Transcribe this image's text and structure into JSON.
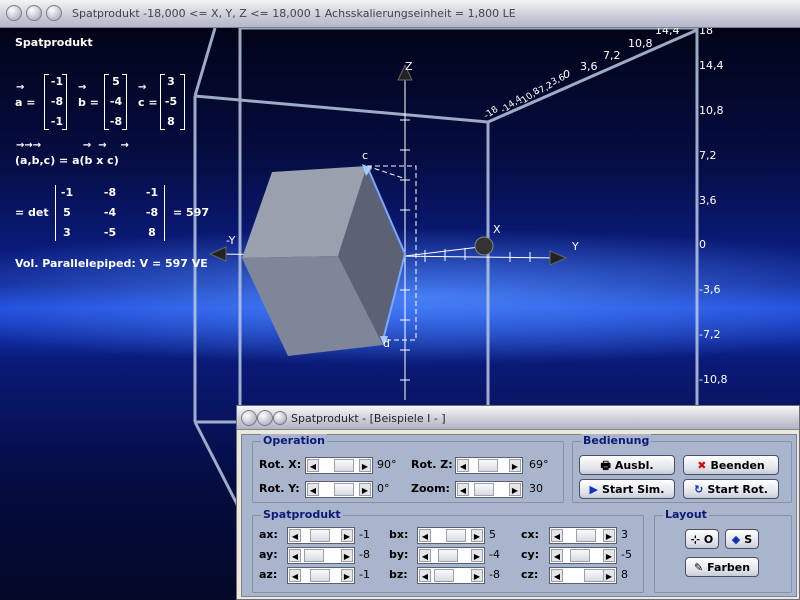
{
  "window": {
    "title": "Spatprodukt   -18,000 <= X, Y, Z <= 18,000    1 Achsskalierungseinheit = 1,800 LE"
  },
  "info": {
    "heading": "Spatprodukt",
    "vectors": {
      "a_label": "a =",
      "b_label": "b =",
      "c_label": "c =",
      "a": [
        "-1",
        "-8",
        "-1"
      ],
      "b": [
        "5",
        "-4",
        "-8"
      ],
      "c": [
        "3",
        "-5",
        "8"
      ]
    },
    "triple_formula": "(a,b,c) = a(b x c)",
    "det": {
      "prefix": "= det",
      "rows": [
        [
          "-1",
          "-8",
          "-1"
        ],
        [
          "5",
          "-4",
          "-8"
        ],
        [
          "3",
          "-5",
          "8"
        ]
      ],
      "result": "= 597"
    },
    "volume": "Vol. Parallelepiped: V = 597 VE"
  },
  "axes": {
    "x_label": "X",
    "y_label": "Y",
    "z_label": "Z",
    "neg_y_label": "-Y",
    "vec_c_label": "c",
    "vec_d_label": "d",
    "right_ticks": [
      "18",
      "14,4",
      "10,8",
      "7,2",
      "3,6",
      "0",
      "-3,6",
      "-7,2",
      "-10,8"
    ],
    "top_ticks": [
      "-18",
      "-14,4",
      "-10,8",
      "-7,2",
      "-3,6",
      "0",
      "3,6",
      "7,2",
      "10,8",
      "14,4"
    ]
  },
  "dialog": {
    "title": "Spatprodukt - [Beispiele I - ]",
    "operation": {
      "label": "Operation",
      "rot_x_label": "Rot. X:",
      "rot_x_value": "90°",
      "rot_y_label": "Rot. Y:",
      "rot_y_value": "0°",
      "rot_z_label": "Rot. Z:",
      "rot_z_value": "69°",
      "zoom_label": "Zoom:",
      "zoom_value": "30"
    },
    "bedienung": {
      "label": "Bedienung",
      "ausbl": "Ausbl.",
      "beenden": "Beenden",
      "start_sim": "Start Sim.",
      "start_rot": "Start Rot."
    },
    "spatprodukt": {
      "label": "Spatprodukt",
      "rows": [
        {
          "a_label": "ax:",
          "a_val": "-1",
          "b_label": "bx:",
          "b_val": "5",
          "c_label": "cx:",
          "c_val": "3"
        },
        {
          "a_label": "ay:",
          "a_val": "-8",
          "b_label": "by:",
          "b_val": "-4",
          "c_label": "cy:",
          "c_val": "-5"
        },
        {
          "a_label": "az:",
          "a_val": "-1",
          "b_label": "bz:",
          "b_val": "-8",
          "c_label": "cz:",
          "c_val": "8"
        }
      ]
    },
    "layout": {
      "label": "Layout",
      "btn_o": "O",
      "btn_s": "S",
      "farben": "Farben"
    }
  }
}
